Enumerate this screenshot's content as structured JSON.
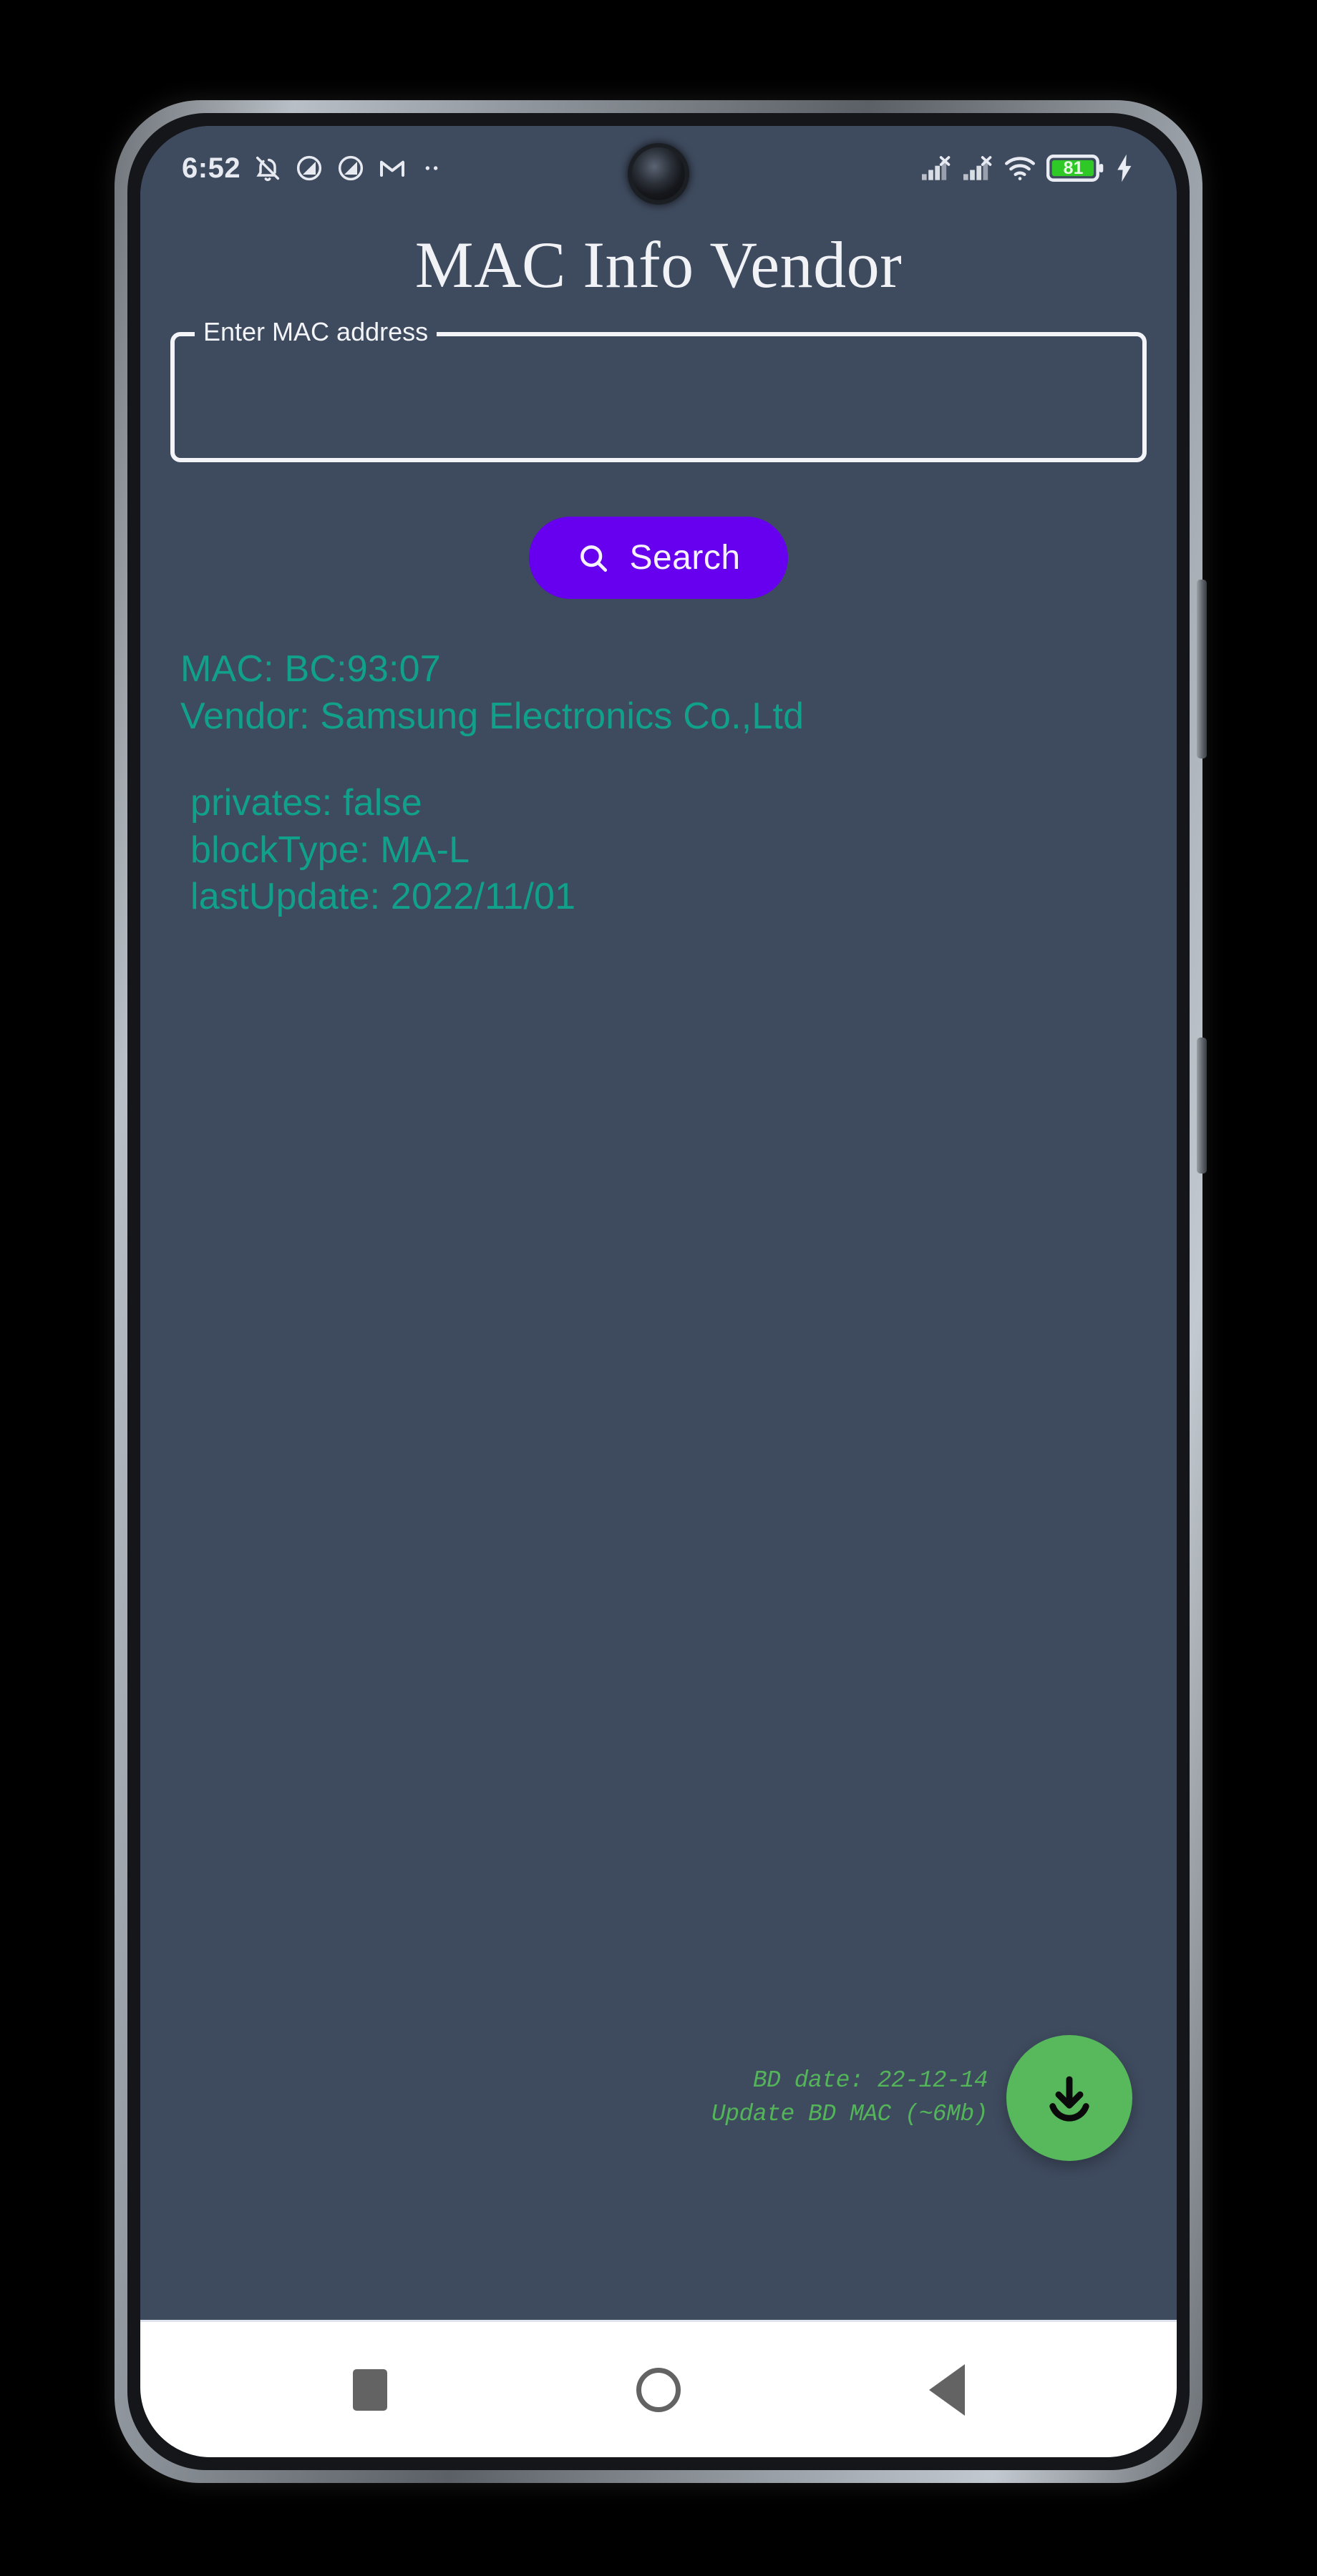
{
  "status_bar": {
    "time": "6:52",
    "battery_percent": "81",
    "left_icons": [
      "notifications-off-icon",
      "do-not-disturb-icon",
      "do-not-disturb-icon",
      "gmail-icon",
      "more-dots-icon"
    ],
    "right_icons": [
      "signal-1-no-sim-icon",
      "signal-2-no-sim-icon",
      "wifi-icon",
      "battery-icon",
      "charging-bolt-icon"
    ]
  },
  "app": {
    "title": "MAC Info Vendor"
  },
  "search_field": {
    "label": "Enter MAC address",
    "value": "",
    "placeholder": ""
  },
  "search_button": {
    "label": "Search",
    "icon": "search-icon",
    "color": "#6600ee"
  },
  "results": {
    "mac_line": "MAC: BC:93:07",
    "vendor_line": "Vendor: Samsung Electronics Co.,Ltd",
    "details": [
      "privates: false",
      "blockType: MA-L",
      "lastUpdate: 2022/11/01"
    ],
    "text_color": "#11a089"
  },
  "database": {
    "bd_date_line": "BD date: 22-12-14",
    "update_line": "Update BD MAC (~6Mb)",
    "text_color": "#54b45a",
    "download_button_icon": "download-icon",
    "download_button_color": "#57b85c"
  },
  "nav_bar": {
    "recents_label": "recents",
    "home_label": "home",
    "back_label": "back"
  }
}
